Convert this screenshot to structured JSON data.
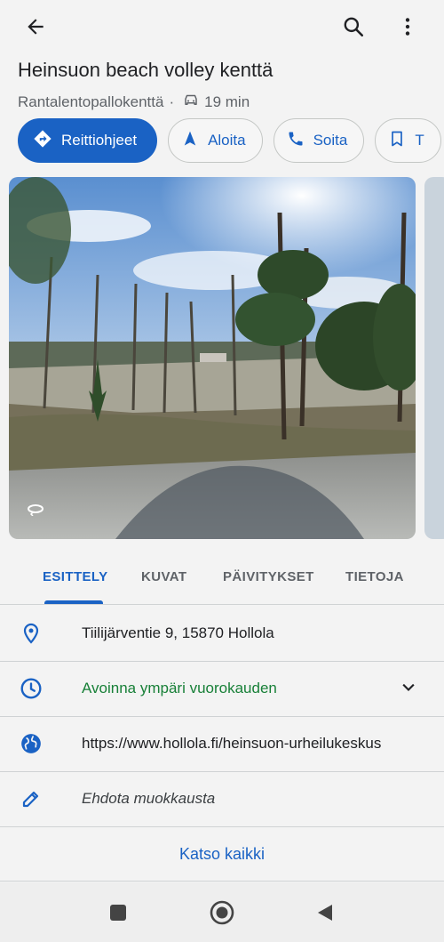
{
  "header": {
    "back_icon": "arrow-back-icon",
    "search_icon": "search-icon",
    "more_icon": "more-vert-icon"
  },
  "place": {
    "title": "Heinsuon beach volley kenttä",
    "category": "Rantalentopallokenttä",
    "separator": "·",
    "drive_icon": "car-icon",
    "drive_time": "19 min"
  },
  "actions": [
    {
      "label": "Reittiohjeet",
      "icon": "directions-icon"
    },
    {
      "label": "Aloita",
      "icon": "navigation-arrow-icon"
    },
    {
      "label": "Soita",
      "icon": "phone-icon"
    },
    {
      "label": "T",
      "icon": "bookmark-icon"
    }
  ],
  "photo": {
    "icon": "street-view-360-icon"
  },
  "tabs": [
    {
      "label": "ESITTELY",
      "active": true
    },
    {
      "label": "KUVAT",
      "active": false
    },
    {
      "label": "PÄIVITYKSET",
      "active": false
    },
    {
      "label": "TIETOJA",
      "active": false
    }
  ],
  "info": {
    "address": "Tiilijärventie 9, 15870 Hollola",
    "hours": "Avoinna ympäri vuorokauden",
    "website": "https://www.hollola.fi/heinsuon-urheilukeskus",
    "suggest_edit": "Ehdota muokkausta"
  },
  "see_all": "Katso kaikki",
  "colors": {
    "accent": "#1a62c4",
    "open_green": "#188038",
    "background": "#f3f3f3"
  },
  "system_nav": {
    "recents_icon": "square-icon",
    "home_icon": "circle-home-icon",
    "back_icon": "triangle-back-icon"
  }
}
